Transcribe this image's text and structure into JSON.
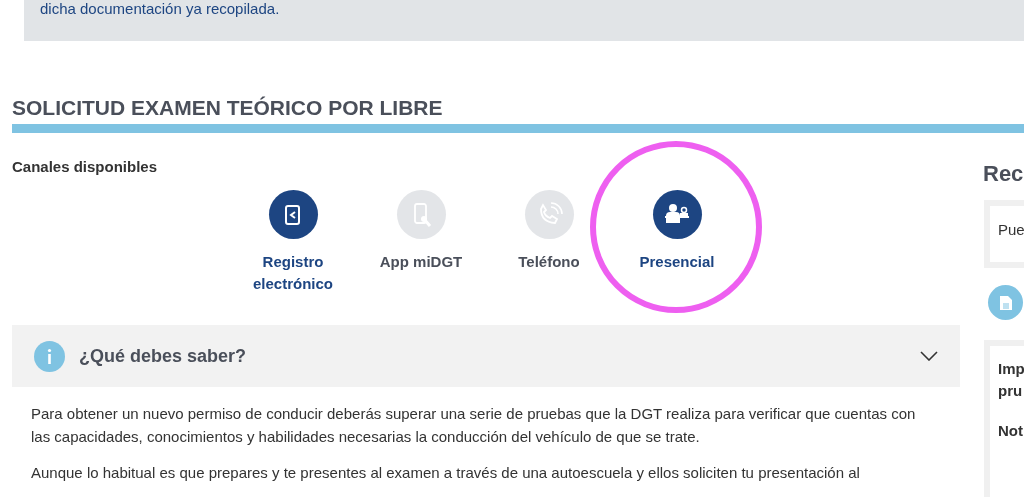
{
  "notice": {
    "text": "dicha documentación ya recopilada."
  },
  "title": "SOLICITUD EXAMEN TEÓRICO POR LIBRE",
  "channels_label": "Canales disponibles",
  "channels": [
    {
      "kind": "document",
      "label": "Registro electrónico",
      "enabled": true,
      "highlighted": false
    },
    {
      "kind": "app",
      "label": "App miDGT",
      "enabled": false,
      "highlighted": false
    },
    {
      "kind": "phone",
      "label": "Teléfono",
      "enabled": false,
      "highlighted": false
    },
    {
      "kind": "person",
      "label": "Presencial",
      "enabled": true,
      "highlighted": true
    }
  ],
  "accordion": {
    "title": "¿Qué debes saber?",
    "expanded": true,
    "paragraphs": [
      "Para obtener un nuevo permiso de conducir deberás superar una serie de pruebas que la DGT realiza para verificar que cuentas con las capacidades, conocimientos y habilidades necesarias la conducción del vehículo de que se trate.",
      "Aunque lo habitual es que prepares y te presentes al examen a través de una autoescuela y ellos soliciten tu presentación al"
    ]
  },
  "sidebar": {
    "title": "Rec",
    "box_text": "Pue",
    "details": [
      "Imp",
      "pru",
      "Not"
    ]
  }
}
